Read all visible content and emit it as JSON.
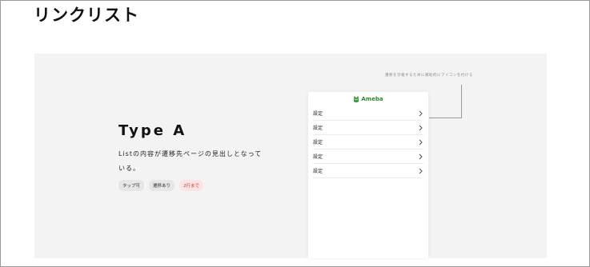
{
  "page": {
    "title": "リンクリスト"
  },
  "variant": {
    "title": "Type A",
    "description": "Listの内容が遷移先ページの見出しとなっている。",
    "tags": [
      {
        "label": "タップ可"
      },
      {
        "label": "遷移あり"
      },
      {
        "label": "2行まで",
        "color": "#d9322e"
      }
    ]
  },
  "annotation": {
    "text": "遷移を示唆するために補助的にアイコンを付ける"
  },
  "phone": {
    "logo_text": "Ameba",
    "brand_color": "#2d8a2d",
    "items": [
      {
        "label": "設定",
        "icon": "chevron-right-icon"
      },
      {
        "label": "設定",
        "icon": "chevron-right-icon"
      },
      {
        "label": "設定",
        "icon": "chevron-right-icon"
      },
      {
        "label": "設定",
        "icon": "chevron-right-icon"
      },
      {
        "label": "設定",
        "icon": "chevron-right-icon"
      }
    ]
  }
}
